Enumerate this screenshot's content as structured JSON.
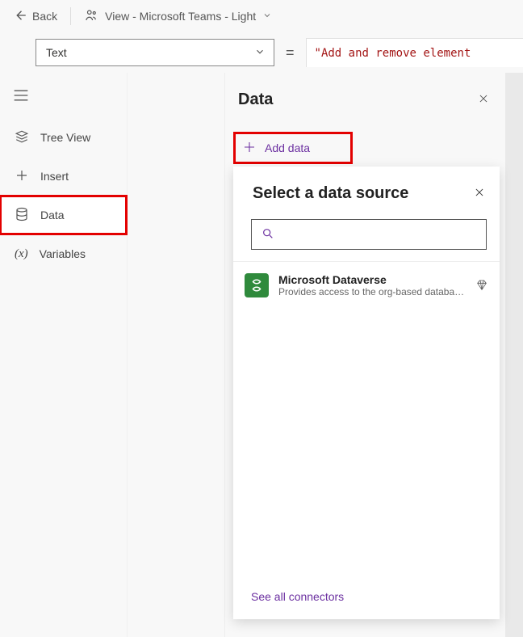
{
  "header": {
    "back_label": "Back",
    "view_label": "View - Microsoft Teams - Light"
  },
  "formula": {
    "property": "Text",
    "eq": "=",
    "value": "\"Add and remove element"
  },
  "rail": {
    "items": [
      {
        "key": "tree",
        "label": "Tree View"
      },
      {
        "key": "insert",
        "label": "Insert"
      },
      {
        "key": "data",
        "label": "Data"
      },
      {
        "key": "variables",
        "label": "Variables"
      }
    ]
  },
  "panel": {
    "title": "Data",
    "add_label": "Add data"
  },
  "popup": {
    "title": "Select a data source",
    "search_placeholder": "",
    "sources": [
      {
        "title": "Microsoft Dataverse",
        "desc": "Provides access to the org-based databas…"
      }
    ],
    "see_all": "See all connectors"
  }
}
